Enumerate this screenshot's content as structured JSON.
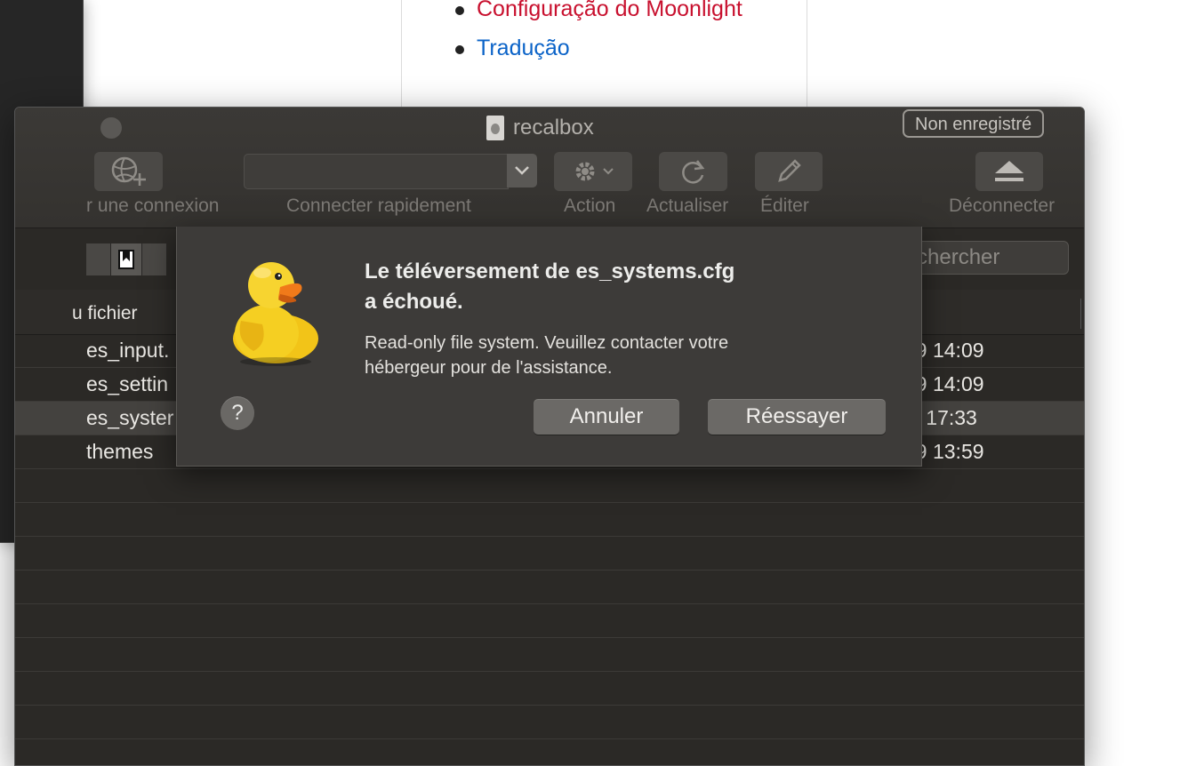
{
  "web_page": {
    "links": [
      {
        "label": "Configuração do Moonlight",
        "color": "#c8102e"
      },
      {
        "label": "Tradução",
        "color": "#0b63c8"
      }
    ]
  },
  "window": {
    "title": "recalbox",
    "badge": "Non enregistré",
    "toolbar": {
      "open_connection_label": "r une connexion",
      "quick_connect_label": "Connecter rapidement",
      "action_label": "Action",
      "refresh_label": "Actualiser",
      "edit_label": "Éditer",
      "disconnect_label": "Déconnecter"
    },
    "search_placeholder": "chercher",
    "column_header": "u fichier",
    "files": [
      {
        "name": "es_input.",
        "date": "19 14:09",
        "selected": false
      },
      {
        "name": "es_settin",
        "date": "19 14:09",
        "selected": false
      },
      {
        "name": "es_syster",
        "date": "ui 17:33",
        "selected": true
      },
      {
        "name": "themes",
        "date": "19 13:59",
        "selected": false
      }
    ]
  },
  "alert": {
    "title_line1": "Le téléversement de es_systems.cfg",
    "title_line2": "a échoué.",
    "message_line1": "Read-only file system. Veuillez contacter votre",
    "message_line2": "hébergeur pour de l'assistance.",
    "help_label": "?",
    "cancel_label": "Annuler",
    "retry_label": "Réessayer"
  },
  "colors": {
    "window_bg": "#2b2926",
    "sheet_bg": "#3d3b39",
    "button_bg": "#6b6966"
  },
  "icons": [
    "globe-plus-icon",
    "chevron-down-icon",
    "gear-icon",
    "refresh-icon",
    "pencil-icon",
    "eject-icon",
    "bookmark-icon",
    "document-icon",
    "cyberduck-duck-icon"
  ]
}
